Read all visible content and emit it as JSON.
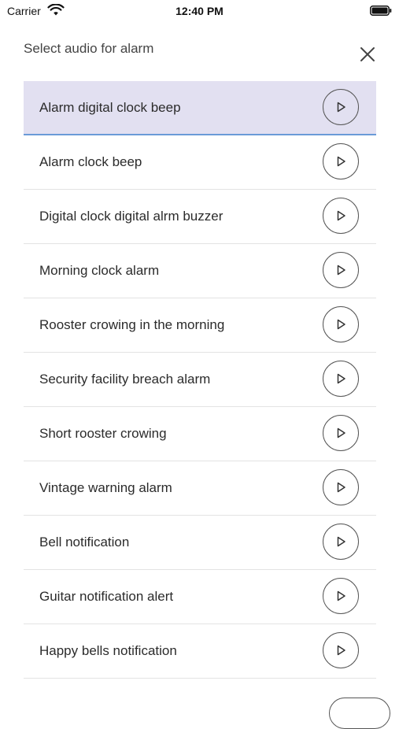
{
  "status_bar": {
    "carrier": "Carrier",
    "time": "12:40 PM"
  },
  "header": {
    "title": "Select audio for alarm",
    "close_icon": "close-icon"
  },
  "selected_index": 0,
  "sounds": [
    {
      "label": "Alarm digital clock beep"
    },
    {
      "label": "Alarm clock beep"
    },
    {
      "label": "Digital clock digital alrm buzzer"
    },
    {
      "label": "Morning clock alarm"
    },
    {
      "label": "Rooster crowing in the morning"
    },
    {
      "label": "Security facility breach alarm"
    },
    {
      "label": "Short rooster crowing"
    },
    {
      "label": "Vintage warning alarm"
    },
    {
      "label": "Bell notification"
    },
    {
      "label": "Guitar notification alert"
    },
    {
      "label": "Happy bells notification"
    }
  ],
  "colors": {
    "selected_bg": "#e2e0f1",
    "selected_underline": "#6a9bd8",
    "divider": "#e3e3e3"
  }
}
